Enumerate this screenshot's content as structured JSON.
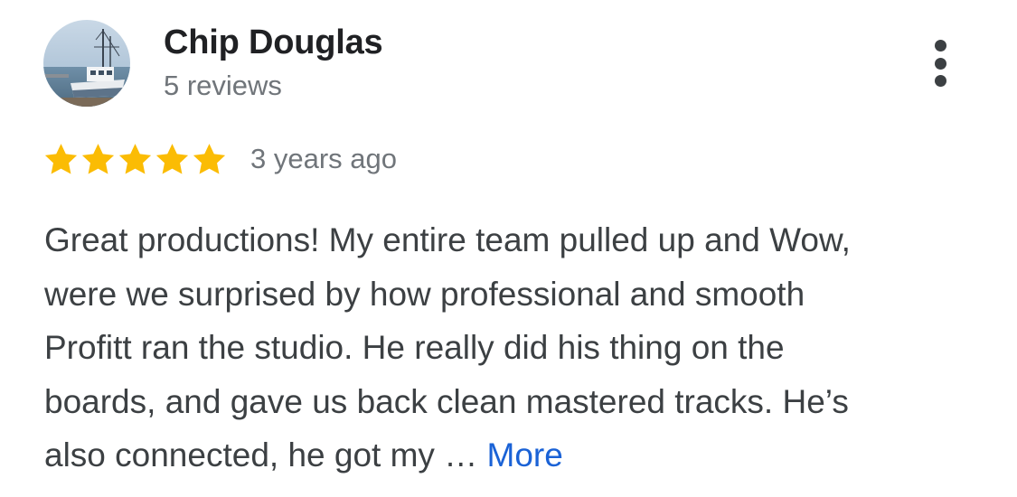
{
  "reviewer": {
    "name": "Chip Douglas",
    "review_count": "5 reviews",
    "avatar": "boat-harbor-photo"
  },
  "menu": {
    "icon": "more-vertical-icon"
  },
  "rating": {
    "stars": 5,
    "max_stars": 5,
    "star_color": "#fbbc04",
    "time_ago": "3 years ago"
  },
  "review": {
    "text_lines": [
      "Great productions! My entire team pulled up and Wow,",
      "were we surprised by how professional and smooth",
      "Profitt ran the studio. He really did his thing on the",
      "boards, and gave us back clean mastered tracks. He’s",
      "also connected, he got my …"
    ],
    "more_label": "More",
    "more_color": "#1a62d6"
  }
}
